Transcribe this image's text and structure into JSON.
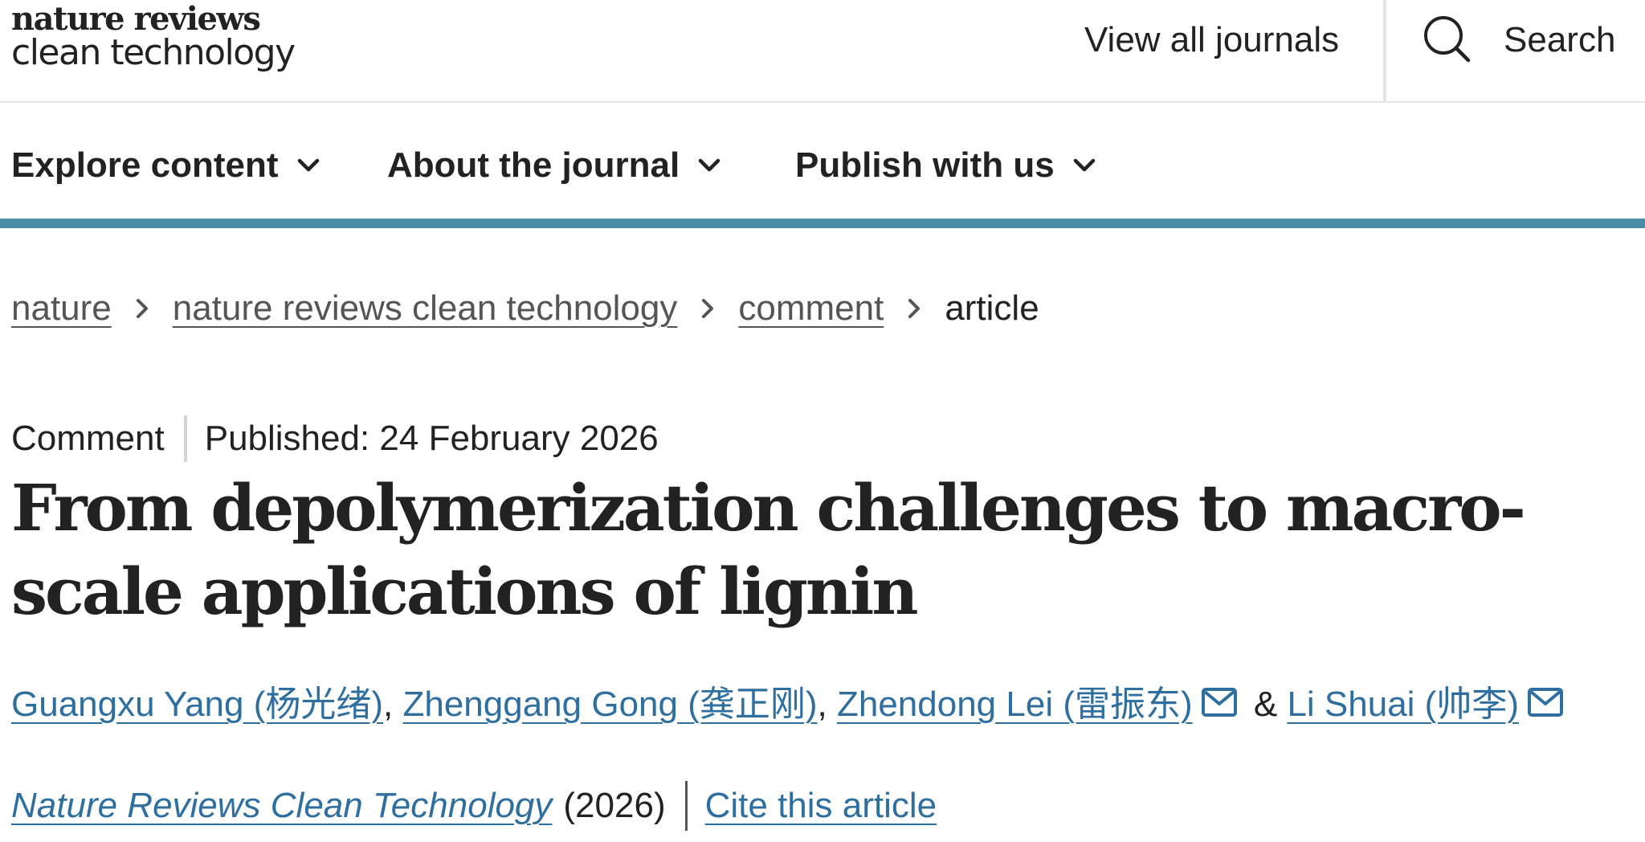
{
  "header": {
    "logo_line1": "nature reviews",
    "logo_line2": "clean technology",
    "view_all_journals": "View all journals",
    "search_label": "Search"
  },
  "nav": {
    "items": [
      {
        "label": "Explore content"
      },
      {
        "label": "About the journal"
      },
      {
        "label": "Publish with us"
      }
    ]
  },
  "breadcrumb": {
    "items": [
      "nature",
      "nature reviews clean technology",
      "comment"
    ],
    "current": "article"
  },
  "article": {
    "type": "Comment",
    "published": "Published: 24 February 2026",
    "title": "From depolymerization challenges to macro-scale applications of lignin",
    "authors": [
      {
        "name": "Guangxu Yang  (杨光绪)",
        "separator": ", "
      },
      {
        "name": "Zhenggang Gong  (龚正刚)",
        "separator": ", "
      },
      {
        "name": "Zhendong Lei  (雷振东)",
        "separator": " & "
      },
      {
        "name": "Li Shuai  (帅李)",
        "separator": ""
      }
    ],
    "journal": "Nature Reviews Clean Technology",
    "year": "(2026)",
    "cite_label": "Cite this article"
  },
  "colors": {
    "accent_bar": "#4b8ea3",
    "link": "#2f6f9f",
    "text": "#222222"
  },
  "icons": {
    "search": "magnifier-icon",
    "nav_chevron": "chevron-down-icon",
    "breadcrumb_sep": "chevron-right-icon",
    "author_mail": "mail-icon"
  }
}
